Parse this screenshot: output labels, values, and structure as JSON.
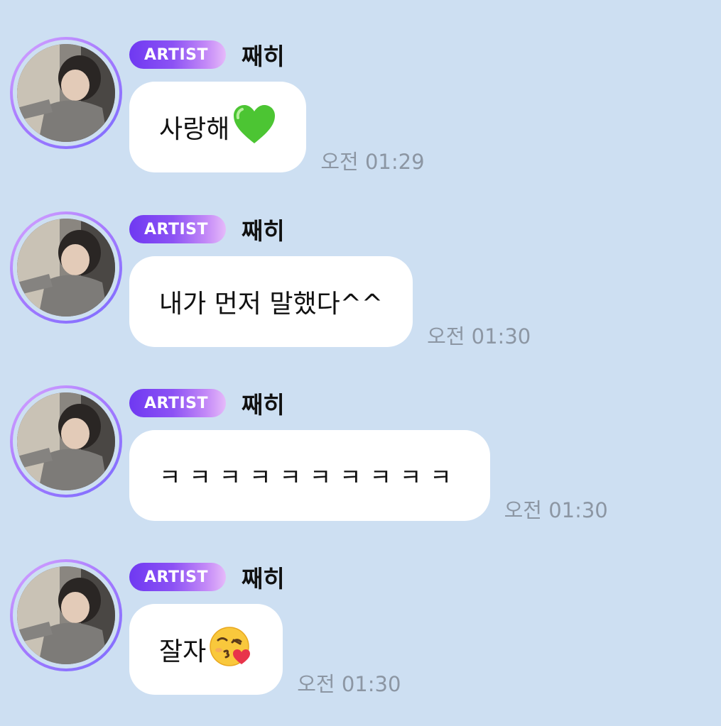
{
  "messages": [
    {
      "badge": "ARTIST",
      "sender": "째히",
      "text": "사랑해",
      "emoji": "green-heart",
      "time": "오전 01:29"
    },
    {
      "badge": "ARTIST",
      "sender": "째히",
      "text": "내가 먼저 말했다^^",
      "emoji": "",
      "time": "오전 01:30"
    },
    {
      "badge": "ARTIST",
      "sender": "째히",
      "text": "ㅋㅋㅋㅋㅋㅋㅋㅋㅋㅋ",
      "emoji": "",
      "time": "오전 01:30"
    },
    {
      "badge": "ARTIST",
      "sender": "째히",
      "text": "잘자",
      "emoji": "face-blowing-kiss",
      "time": "오전 01:30"
    }
  ],
  "colors": {
    "background": "#cddff2",
    "bubble": "#ffffff",
    "badge_start": "#6f39f2",
    "badge_end": "#e6bafa",
    "timestamp": "#8c96a3"
  }
}
